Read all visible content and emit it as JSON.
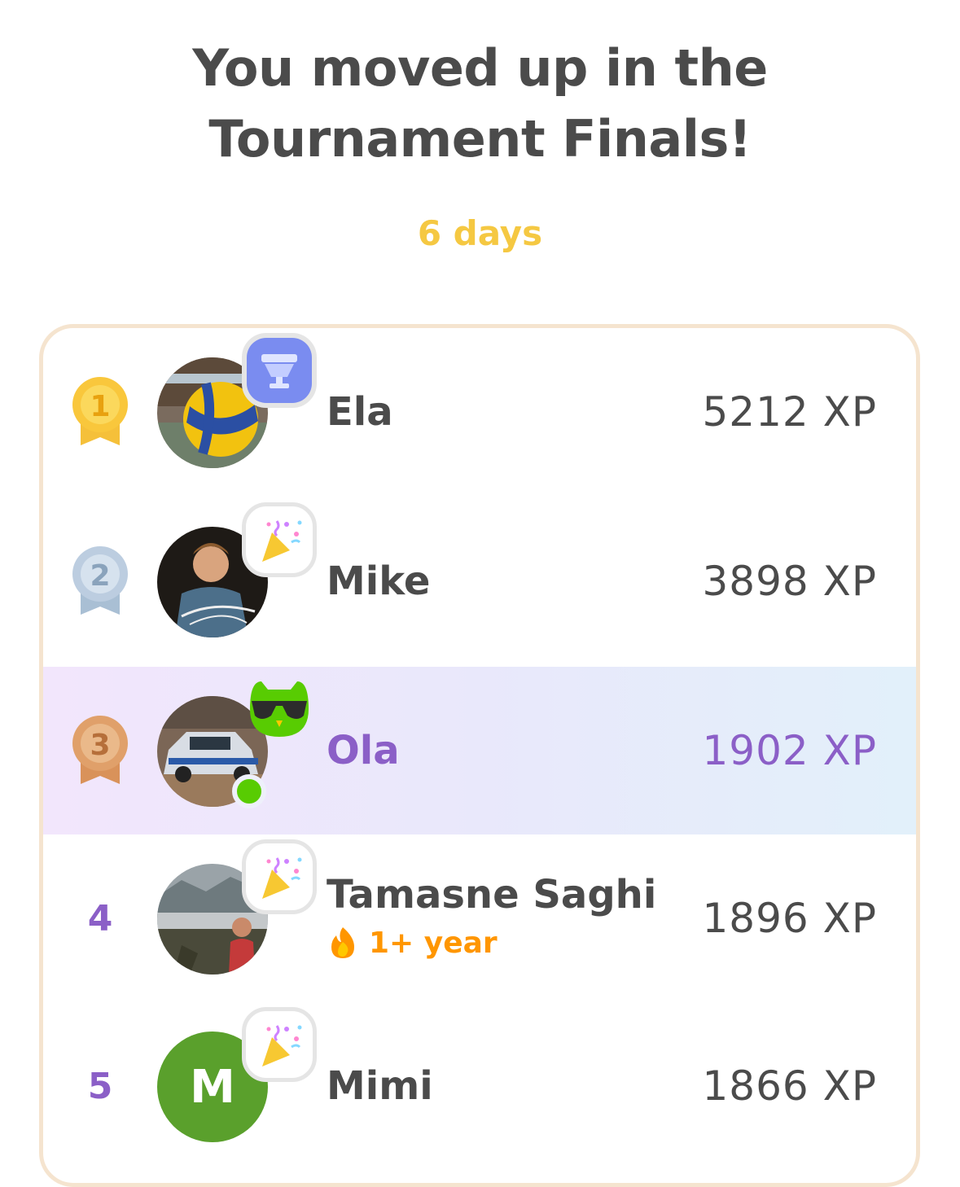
{
  "header": {
    "title_line1": "You moved up in the",
    "title_line2": "Tournament Finals!",
    "time_left": "6 days"
  },
  "colors": {
    "accent_purple": "#8b5fc7",
    "gold": "#f5c842",
    "streak_orange": "#ff9600",
    "online_green": "#58cc02"
  },
  "leaderboard": [
    {
      "rank": "1",
      "medal": "gold",
      "name": "Ela",
      "xp": "5212 XP",
      "badge": "trophy-icon",
      "avatar": "volleyball-photo"
    },
    {
      "rank": "2",
      "medal": "silver",
      "name": "Mike",
      "xp": "3898 XP",
      "badge": "party-popper-icon",
      "avatar": "man-photo"
    },
    {
      "rank": "3",
      "medal": "bronze",
      "name": "Ola",
      "xp": "1902 XP",
      "badge": "owl-sunglasses-icon",
      "avatar": "rally-car-photo",
      "current_user": true,
      "online": true
    },
    {
      "rank": "4",
      "name": "Tamasne Saghi",
      "xp": "1896 XP",
      "badge": "party-popper-icon",
      "avatar": "landscape-photo",
      "streak": "1+ year"
    },
    {
      "rank": "5",
      "name": "Mimi",
      "xp": "1866 XP",
      "badge": "party-popper-icon",
      "avatar_initial": "M"
    }
  ]
}
